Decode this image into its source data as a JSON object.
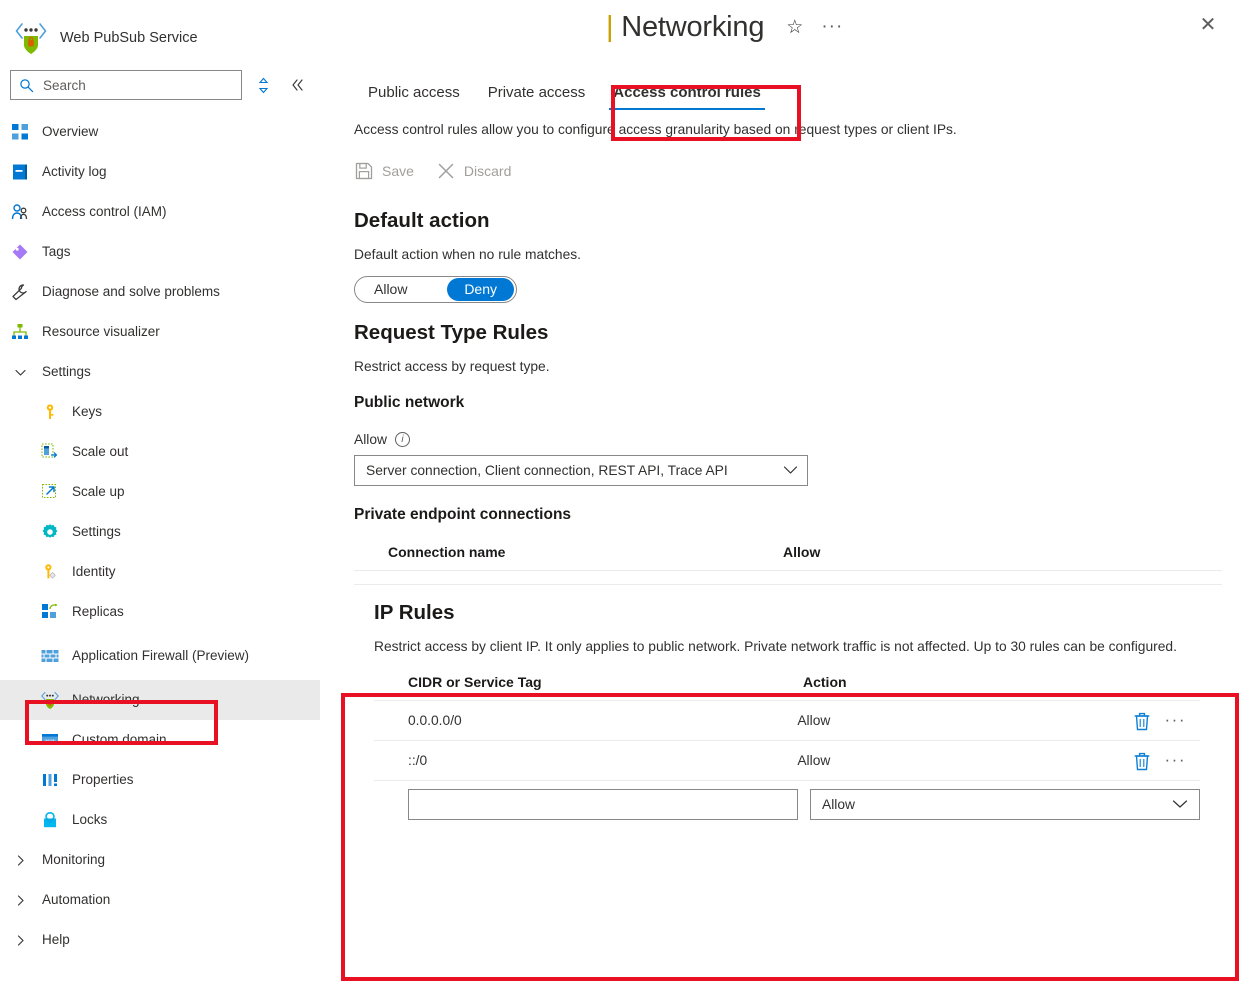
{
  "sidebar": {
    "resource_title": "Web PubSub Service",
    "resource_icon": "web-pubsub-icon",
    "search": {
      "placeholder": "Search",
      "value": "",
      "icon": "search-icon"
    },
    "sort_icon": "sort-icon",
    "collapse_icon": "collapse-double-chevron-icon",
    "items": [
      {
        "label": "Overview",
        "icon": "overview-icon",
        "level": 0,
        "selected": false
      },
      {
        "label": "Activity log",
        "icon": "activity-log-icon",
        "level": 0,
        "selected": false
      },
      {
        "label": "Access control (IAM)",
        "icon": "access-control-icon",
        "level": 0,
        "selected": false
      },
      {
        "label": "Tags",
        "icon": "tags-icon",
        "level": 0,
        "selected": false
      },
      {
        "label": "Diagnose and solve problems",
        "icon": "wrench-icon",
        "level": 0,
        "selected": false
      },
      {
        "label": "Resource visualizer",
        "icon": "resource-visualizer-icon",
        "level": 0,
        "selected": false
      },
      {
        "label": "Settings",
        "icon": "chevron-down-icon",
        "level": 0,
        "selected": false,
        "group": true
      },
      {
        "label": "Keys",
        "icon": "key-icon",
        "level": 1,
        "selected": false
      },
      {
        "label": "Scale out",
        "icon": "scale-out-icon",
        "level": 1,
        "selected": false
      },
      {
        "label": "Scale up",
        "icon": "scale-up-icon",
        "level": 1,
        "selected": false
      },
      {
        "label": "Settings",
        "icon": "gear-icon",
        "level": 1,
        "selected": false
      },
      {
        "label": "Identity",
        "icon": "identity-key-icon",
        "level": 1,
        "selected": false
      },
      {
        "label": "Replicas",
        "icon": "replicas-icon",
        "level": 1,
        "selected": false
      },
      {
        "label": "Application Firewall (Preview)",
        "icon": "firewall-icon",
        "level": 1,
        "selected": false
      },
      {
        "label": "Networking",
        "icon": "networking-icon",
        "level": 1,
        "selected": true
      },
      {
        "label": "Custom domain",
        "icon": "custom-domain-icon",
        "level": 1,
        "selected": false
      },
      {
        "label": "Properties",
        "icon": "properties-icon",
        "level": 1,
        "selected": false
      },
      {
        "label": "Locks",
        "icon": "lock-icon",
        "level": 1,
        "selected": false
      },
      {
        "label": "Monitoring",
        "icon": "chevron-right-icon",
        "level": 0,
        "selected": false,
        "group": true
      },
      {
        "label": "Automation",
        "icon": "chevron-right-icon",
        "level": 0,
        "selected": false,
        "group": true
      },
      {
        "label": "Help",
        "icon": "chevron-right-icon",
        "level": 0,
        "selected": false,
        "group": true
      }
    ]
  },
  "header": {
    "title_prefix": "|",
    "title": "Networking",
    "favorite_icon": "star-icon",
    "more_icon": "ellipsis-icon",
    "close_icon": "close-icon"
  },
  "tabs": [
    {
      "label": "Public access",
      "active": false
    },
    {
      "label": "Private access",
      "active": false
    },
    {
      "label": "Access control rules",
      "active": true
    }
  ],
  "main": {
    "lead": "Access control rules allow you to configure access granularity based on request types or client IPs.",
    "commands": [
      {
        "label": "Save",
        "icon": "save-icon",
        "enabled": false
      },
      {
        "label": "Discard",
        "icon": "discard-x-icon",
        "enabled": false
      }
    ],
    "default_action": {
      "heading": "Default action",
      "description": "Default action when no rule matches.",
      "options": [
        "Allow",
        "Deny"
      ],
      "selected": "Deny"
    },
    "request_type_rules": {
      "heading": "Request Type Rules",
      "description": "Restrict access by request type.",
      "public_network": {
        "heading": "Public network",
        "field_label": "Allow",
        "info_icon": "info-icon",
        "dropdown_value": "Server connection, Client connection, REST API, Trace API",
        "caret_icon": "chevron-down-icon"
      },
      "private_endpoint_connections": {
        "heading": "Private endpoint connections",
        "columns": [
          "Connection name",
          "Allow"
        ],
        "rows": []
      }
    },
    "ip_rules": {
      "heading": "IP Rules",
      "description": "Restrict access by client IP. It only applies to public network. Private network traffic is not affected. Up to 30 rules can be configured.",
      "columns": [
        "CIDR or Service Tag",
        "Action"
      ],
      "rows": [
        {
          "cidr": "0.0.0.0/0",
          "action": "Allow",
          "delete_icon": "trash-icon",
          "more_icon": "ellipsis-icon"
        },
        {
          "cidr": "::/0",
          "action": "Allow",
          "delete_icon": "trash-icon",
          "more_icon": "ellipsis-icon"
        }
      ],
      "new_row": {
        "cidr_placeholder": "",
        "cidr_value": "",
        "action_value": "Allow",
        "caret_icon": "chevron-down-icon"
      }
    }
  },
  "colors": {
    "accent": "#0078d4",
    "highlight_box": "#e81123",
    "selected_nav_bg": "#eaeaea",
    "text": "#323130"
  }
}
